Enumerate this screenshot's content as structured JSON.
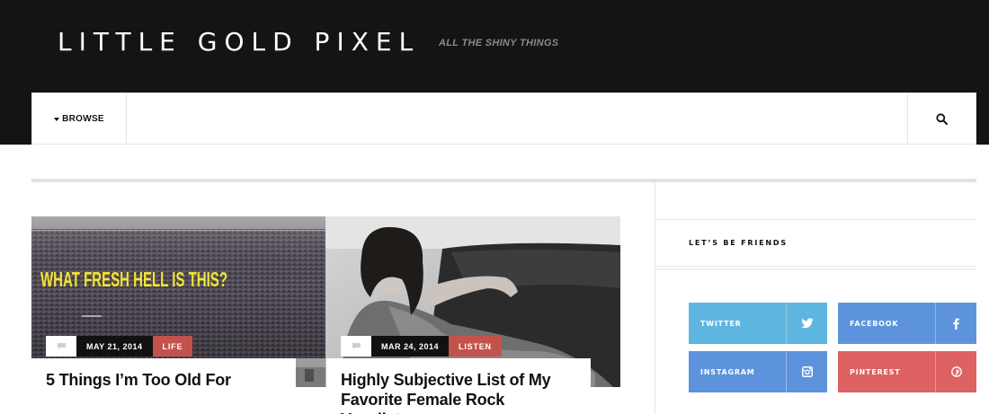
{
  "site": {
    "title": "LITTLE GOLD PIXEL",
    "tagline": "ALL THE SHINY THINGS"
  },
  "nav": {
    "browse_label": "BROWSE",
    "browse_icon": "caret-down-icon",
    "search_icon": "search-icon"
  },
  "posts": [
    {
      "image_caption": "WHAT FRESH HELL IS THIS?",
      "image_caption_color": "#f2e533",
      "comment_icon": "comment-icon",
      "date": "MAY 21, 2014",
      "category": "LIFE",
      "title": "5 Things I’m Too Old For"
    },
    {
      "comment_icon": "comment-icon",
      "date": "MAR 24, 2014",
      "category": "LISTEN",
      "title": "Highly Subjective List of My Favorite Female Rock Vocalists"
    }
  ],
  "sidebar": {
    "widget_title": "LET’S BE FRIENDS",
    "social": [
      {
        "label": "TWITTER",
        "icon": "twitter-icon",
        "color": "#5eb6e0"
      },
      {
        "label": "FACEBOOK",
        "icon": "facebook-icon",
        "color": "#5d93dc"
      },
      {
        "label": "INSTAGRAM",
        "icon": "instagram-icon",
        "color": "#5d93dc"
      },
      {
        "label": "PINTEREST",
        "icon": "pinterest-icon",
        "color": "#de6262"
      }
    ]
  },
  "colors": {
    "header_bg": "#141414",
    "category_bg": "#c4524c",
    "date_bg": "#111111"
  }
}
